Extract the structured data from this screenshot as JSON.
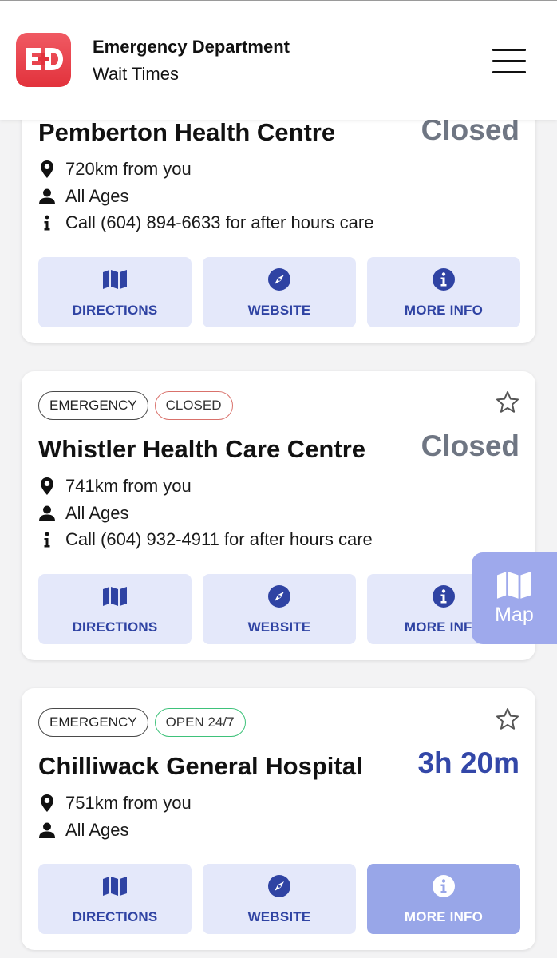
{
  "header": {
    "logo_text": "ED",
    "title": "Emergency Department",
    "subtitle": "Wait Times"
  },
  "actions_labels": {
    "directions": "DIRECTIONS",
    "website": "WEBSITE",
    "more_info": "MORE INFO"
  },
  "cards": [
    {
      "name": "Pemberton Health Centre",
      "status": "Closed",
      "distance": "720km from you",
      "ages": "All Ages",
      "note": "Call (604) 894-6633 for after hours care"
    },
    {
      "badges": [
        "EMERGENCY",
        "CLOSED"
      ],
      "name": "Whistler Health Care Centre",
      "status": "Closed",
      "distance": "741km from you",
      "ages": "All Ages",
      "note": "Call (604) 932-4911 for after hours care"
    },
    {
      "badges": [
        "EMERGENCY",
        "OPEN 24/7"
      ],
      "name": "Chilliwack General Hospital",
      "status": "3h 20m",
      "distance": "751km from you",
      "ages": "All Ages"
    }
  ],
  "map_button": {
    "label": "Map"
  },
  "colors": {
    "accent": "#3347a8",
    "button_bg": "#e4e8fa",
    "button_active_bg": "#98a6e8",
    "closed_text": "#6f7683",
    "logo_red": "#e2323c",
    "badge_closed_border": "#d9716b",
    "badge_open_border": "#3ec27a"
  },
  "icons": {
    "menu": "hamburger-icon",
    "favorite": "star-outline-icon",
    "distance": "location-pin-icon",
    "ages": "person-icon",
    "note": "info-letter-icon",
    "directions": "map-icon",
    "website": "compass-icon",
    "more_info": "info-circle-icon"
  }
}
